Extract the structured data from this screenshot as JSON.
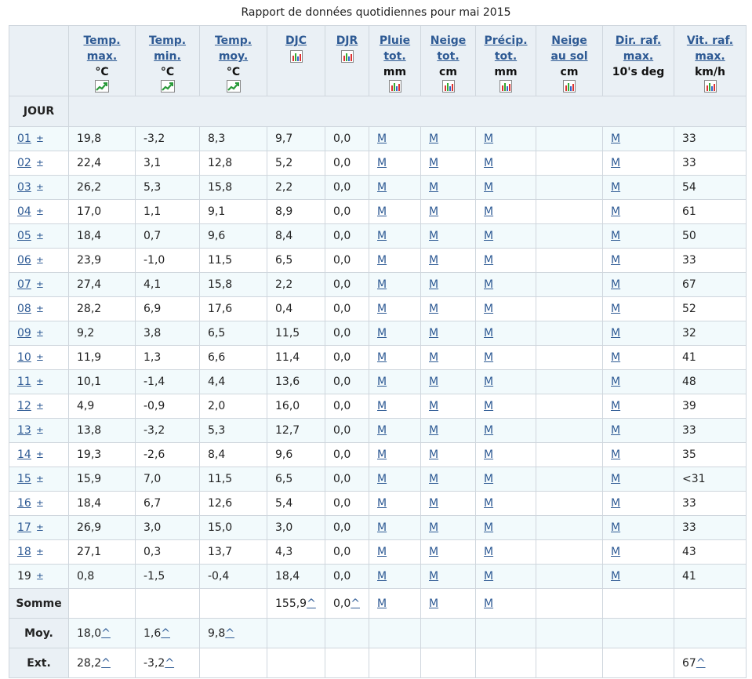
{
  "caption": "Rapport de données quotidiennes pour mai 2015",
  "headers": [
    {
      "l1": "Temp.",
      "l2": "max.",
      "unit": "°C",
      "icon": "trend-chart-icon"
    },
    {
      "l1": "Temp.",
      "l2": "min.",
      "unit": "°C",
      "icon": "trend-chart-icon"
    },
    {
      "l1": "Temp.",
      "l2": "moy.",
      "unit": "°C",
      "icon": "trend-chart-icon"
    },
    {
      "l1": "DJC",
      "l2": "",
      "unit": "",
      "icon": "bar-chart-icon"
    },
    {
      "l1": "DJR",
      "l2": "",
      "unit": "",
      "icon": "bar-chart-icon"
    },
    {
      "l1": "Pluie",
      "l2": "tot.",
      "unit": "mm",
      "icon": "bar-chart-icon"
    },
    {
      "l1": "Neige",
      "l2": "tot.",
      "unit": "cm",
      "icon": "bar-chart-icon"
    },
    {
      "l1": "Précip.",
      "l2": "tot.",
      "unit": "mm",
      "icon": "bar-chart-icon"
    },
    {
      "l1": "Neige",
      "l2": "au sol",
      "unit": "cm",
      "icon": "bar-chart-icon"
    },
    {
      "l1": "Dir. raf.",
      "l2": "max.",
      "unit": "10's deg",
      "icon": ""
    },
    {
      "l1": "Vit. raf.",
      "l2": "max.",
      "unit": "km/h",
      "icon": "bar-chart-icon"
    }
  ],
  "jour_label": "JOUR",
  "rows": [
    [
      "01",
      "19,8",
      "-3,2",
      "8,3",
      "9,7",
      "0,0",
      "M",
      "M",
      "M",
      "",
      "M",
      "33"
    ],
    [
      "02",
      "22,4",
      "3,1",
      "12,8",
      "5,2",
      "0,0",
      "M",
      "M",
      "M",
      "",
      "M",
      "33"
    ],
    [
      "03",
      "26,2",
      "5,3",
      "15,8",
      "2,2",
      "0,0",
      "M",
      "M",
      "M",
      "",
      "M",
      "54"
    ],
    [
      "04",
      "17,0",
      "1,1",
      "9,1",
      "8,9",
      "0,0",
      "M",
      "M",
      "M",
      "",
      "M",
      "61"
    ],
    [
      "05",
      "18,4",
      "0,7",
      "9,6",
      "8,4",
      "0,0",
      "M",
      "M",
      "M",
      "",
      "M",
      "50"
    ],
    [
      "06",
      "23,9",
      "-1,0",
      "11,5",
      "6,5",
      "0,0",
      "M",
      "M",
      "M",
      "",
      "M",
      "33"
    ],
    [
      "07",
      "27,4",
      "4,1",
      "15,8",
      "2,2",
      "0,0",
      "M",
      "M",
      "M",
      "",
      "M",
      "67"
    ],
    [
      "08",
      "28,2",
      "6,9",
      "17,6",
      "0,4",
      "0,0",
      "M",
      "M",
      "M",
      "",
      "M",
      "52"
    ],
    [
      "09",
      "9,2",
      "3,8",
      "6,5",
      "11,5",
      "0,0",
      "M",
      "M",
      "M",
      "",
      "M",
      "32"
    ],
    [
      "10",
      "11,9",
      "1,3",
      "6,6",
      "11,4",
      "0,0",
      "M",
      "M",
      "M",
      "",
      "M",
      "41"
    ],
    [
      "11",
      "10,1",
      "-1,4",
      "4,4",
      "13,6",
      "0,0",
      "M",
      "M",
      "M",
      "",
      "M",
      "48"
    ],
    [
      "12",
      "4,9",
      "-0,9",
      "2,0",
      "16,0",
      "0,0",
      "M",
      "M",
      "M",
      "",
      "M",
      "39"
    ],
    [
      "13",
      "13,8",
      "-3,2",
      "5,3",
      "12,7",
      "0,0",
      "M",
      "M",
      "M",
      "",
      "M",
      "33"
    ],
    [
      "14",
      "19,3",
      "-2,6",
      "8,4",
      "9,6",
      "0,0",
      "M",
      "M",
      "M",
      "",
      "M",
      "35"
    ],
    [
      "15",
      "15,9",
      "7,0",
      "11,5",
      "6,5",
      "0,0",
      "M",
      "M",
      "M",
      "",
      "M",
      "<31"
    ],
    [
      "16",
      "18,4",
      "6,7",
      "12,6",
      "5,4",
      "0,0",
      "M",
      "M",
      "M",
      "",
      "M",
      "33"
    ],
    [
      "17",
      "26,9",
      "3,0",
      "15,0",
      "3,0",
      "0,0",
      "M",
      "M",
      "M",
      "",
      "M",
      "33"
    ],
    [
      "18",
      "27,1",
      "0,3",
      "13,7",
      "4,3",
      "0,0",
      "M",
      "M",
      "M",
      "",
      "M",
      "43"
    ],
    [
      "19",
      "0,8",
      "-1,5",
      "-0,4",
      "18,4",
      "0,0",
      "M",
      "M",
      "M",
      "",
      "M",
      "41"
    ]
  ],
  "linked_days": [
    "01",
    "02",
    "03",
    "04",
    "05",
    "06",
    "07",
    "08",
    "09",
    "10",
    "11",
    "12",
    "13",
    "14",
    "15",
    "16",
    "17",
    "18"
  ],
  "pm_symbol": "±",
  "caret": "^",
  "footer": {
    "somme": {
      "label": "Somme",
      "cells": [
        "",
        "",
        "",
        "155,9",
        "0,0",
        "M",
        "M",
        "M",
        "",
        "",
        ""
      ]
    },
    "moy": {
      "label": "Moy.",
      "cells": [
        "18,0",
        "1,6",
        "9,8",
        "",
        "",
        "",
        "",
        "",
        "",
        "",
        ""
      ]
    },
    "ext": {
      "label": "Ext.",
      "cells": [
        "28,2",
        "-3,2",
        "",
        "",
        "",
        "",
        "",
        "",
        "",
        "",
        "67"
      ]
    }
  }
}
